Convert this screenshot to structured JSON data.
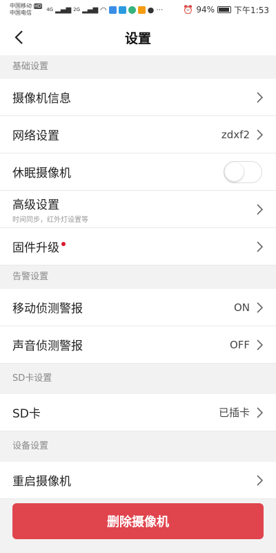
{
  "status_bar": {
    "carrier1": "中国移动",
    "carrier1_badge": "HD",
    "carrier2": "中国电信",
    "net1": "4G",
    "net2": "2G",
    "battery": "94%",
    "time": "下午1:53"
  },
  "header": {
    "title": "设置"
  },
  "sections": {
    "basic": {
      "label": "基础设置",
      "camera_info": "摄像机信息",
      "network": "网络设置",
      "network_value": "zdxf2",
      "sleep": "休眠摄像机",
      "sleep_on": false,
      "advanced": "高级设置",
      "advanced_sub": "时间同步，红外灯设置等",
      "firmware": "固件升级"
    },
    "alarm": {
      "label": "告警设置",
      "motion": "移动侦测警报",
      "motion_value": "ON",
      "sound": "声音侦测警报",
      "sound_value": "OFF"
    },
    "sd": {
      "label": "SD卡设置",
      "sd_card": "SD卡",
      "sd_card_value": "已插卡"
    },
    "device": {
      "label": "设备设置",
      "restart": "重启摄像机"
    }
  },
  "delete_button": "删除摄像机",
  "colors": {
    "danger": "#e0444d",
    "dot": "#d9182a"
  }
}
